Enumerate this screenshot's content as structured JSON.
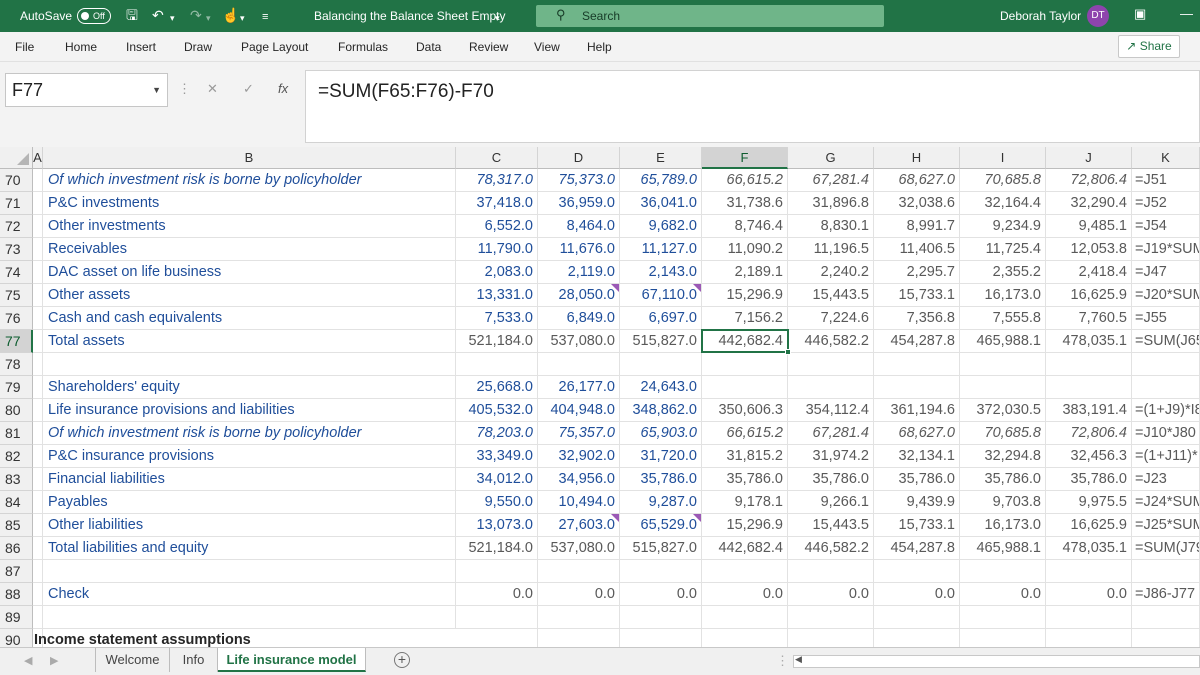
{
  "titlebar": {
    "autosave_label": "AutoSave",
    "autosave_state": "Off",
    "document_title": "Balancing the Balance Sheet Empty",
    "search_placeholder": "Search",
    "user_name": "Deborah Taylor",
    "user_initials": "DT",
    "accent_color": "#217346",
    "avatar_color": "#8e44ad"
  },
  "ribbon": {
    "tabs": [
      "File",
      "Home",
      "Insert",
      "Draw",
      "Page Layout",
      "Formulas",
      "Data",
      "Review",
      "View",
      "Help"
    ],
    "share_label": "Share"
  },
  "formula_bar": {
    "name_box": "F77",
    "formula": "=SUM(F65:F76)-F70"
  },
  "columns": [
    "A",
    "B",
    "C",
    "D",
    "E",
    "F",
    "G",
    "H",
    "I",
    "J",
    "K"
  ],
  "selected_column": "F",
  "selected_row": "77",
  "rows": [
    {
      "num": "70",
      "label": "Of which investment risk is borne by policyholder",
      "style": "italic",
      "values": [
        "78,317.0",
        "75,373.0",
        "65,789.0",
        "66,615.2",
        "67,281.4",
        "68,627.0",
        "70,685.8",
        "72,806.4"
      ],
      "k": "=J51"
    },
    {
      "num": "71",
      "label": "P&C investments",
      "style": "normal",
      "values": [
        "37,418.0",
        "36,959.0",
        "36,041.0",
        "31,738.6",
        "31,896.8",
        "32,038.6",
        "32,164.4",
        "32,290.4"
      ],
      "k": "=J52"
    },
    {
      "num": "72",
      "label": "Other investments",
      "style": "normal",
      "values": [
        "6,552.0",
        "8,464.0",
        "9,682.0",
        "8,746.4",
        "8,830.1",
        "8,991.7",
        "9,234.9",
        "9,485.1"
      ],
      "k": "=J54"
    },
    {
      "num": "73",
      "label": "Receivables",
      "style": "normal",
      "values": [
        "11,790.0",
        "11,676.0",
        "11,127.0",
        "11,090.2",
        "11,196.5",
        "11,406.5",
        "11,725.4",
        "12,053.8"
      ],
      "k": "=J19*SUM"
    },
    {
      "num": "74",
      "label": "DAC asset on life business",
      "style": "normal",
      "values": [
        "2,083.0",
        "2,119.0",
        "2,143.0",
        "2,189.1",
        "2,240.2",
        "2,295.7",
        "2,355.2",
        "2,418.4"
      ],
      "k": "=J47"
    },
    {
      "num": "75",
      "label": "Other assets",
      "style": "normal",
      "values": [
        "13,331.0",
        "28,050.0",
        "67,110.0",
        "15,296.9",
        "15,443.5",
        "15,733.1",
        "16,173.0",
        "16,625.9"
      ],
      "k": "=J20*SUM"
    },
    {
      "num": "76",
      "label": "Cash and cash equivalents",
      "style": "normal",
      "values": [
        "7,533.0",
        "6,849.0",
        "6,697.0",
        "7,156.2",
        "7,224.6",
        "7,356.8",
        "7,555.8",
        "7,760.5"
      ],
      "k": "=J55"
    },
    {
      "num": "77",
      "label": "Total assets",
      "style": "total",
      "values": [
        "521,184.0",
        "537,080.0",
        "515,827.0",
        "442,682.4",
        "446,582.2",
        "454,287.8",
        "465,988.1",
        "478,035.1"
      ],
      "k": "=SUM(J65"
    },
    {
      "num": "78",
      "label": "",
      "style": "normal",
      "values": [
        "",
        "",
        "",
        "",
        "",
        "",
        "",
        ""
      ],
      "k": ""
    },
    {
      "num": "79",
      "label": "Shareholders' equity",
      "style": "normal",
      "values": [
        "25,668.0",
        "26,177.0",
        "24,643.0",
        "",
        "",
        "",
        "",
        ""
      ],
      "k": ""
    },
    {
      "num": "80",
      "label": "Life insurance provisions and liabilities",
      "style": "normal",
      "values": [
        "405,532.0",
        "404,948.0",
        "348,862.0",
        "350,606.3",
        "354,112.4",
        "361,194.6",
        "372,030.5",
        "383,191.4"
      ],
      "k": "=(1+J9)*I8"
    },
    {
      "num": "81",
      "label": "Of which investment risk is borne by policyholder",
      "style": "italic",
      "values": [
        "78,203.0",
        "75,357.0",
        "65,903.0",
        "66,615.2",
        "67,281.4",
        "68,627.0",
        "70,685.8",
        "72,806.4"
      ],
      "k": "=J10*J80"
    },
    {
      "num": "82",
      "label": "P&C insurance provisions",
      "style": "normal",
      "values": [
        "33,349.0",
        "32,902.0",
        "31,720.0",
        "31,815.2",
        "31,974.2",
        "32,134.1",
        "32,294.8",
        "32,456.3"
      ],
      "k": "=(1+J11)*"
    },
    {
      "num": "83",
      "label": "Financial liabilities",
      "style": "normal",
      "values": [
        "34,012.0",
        "34,956.0",
        "35,786.0",
        "35,786.0",
        "35,786.0",
        "35,786.0",
        "35,786.0",
        "35,786.0"
      ],
      "k": "=J23"
    },
    {
      "num": "84",
      "label": "Payables",
      "style": "normal",
      "values": [
        "9,550.0",
        "10,494.0",
        "9,287.0",
        "9,178.1",
        "9,266.1",
        "9,439.9",
        "9,703.8",
        "9,975.5"
      ],
      "k": "=J24*SUM"
    },
    {
      "num": "85",
      "label": "Other liabilities",
      "style": "normal",
      "values": [
        "13,073.0",
        "27,603.0",
        "65,529.0",
        "15,296.9",
        "15,443.5",
        "15,733.1",
        "16,173.0",
        "16,625.9"
      ],
      "k": "=J25*SUM"
    },
    {
      "num": "86",
      "label": "Total liabilities and equity",
      "style": "total",
      "values": [
        "521,184.0",
        "537,080.0",
        "515,827.0",
        "442,682.4",
        "446,582.2",
        "454,287.8",
        "465,988.1",
        "478,035.1"
      ],
      "k": "=SUM(J79"
    },
    {
      "num": "87",
      "label": "",
      "style": "normal",
      "values": [
        "",
        "",
        "",
        "",
        "",
        "",
        "",
        ""
      ],
      "k": ""
    },
    {
      "num": "88",
      "label": "Check",
      "style": "check",
      "values": [
        "0.0",
        "0.0",
        "0.0",
        "0.0",
        "0.0",
        "0.0",
        "0.0",
        "0.0"
      ],
      "k": "=J86-J77"
    },
    {
      "num": "89",
      "label": "",
      "style": "normal",
      "values": [
        "",
        "",
        "",
        "",
        "",
        "",
        "",
        ""
      ],
      "k": ""
    },
    {
      "num": "90",
      "label": "Income statement assumptions",
      "style": "section",
      "values": [
        "",
        "",
        "",
        "",
        "",
        "",
        "",
        ""
      ],
      "k": ""
    }
  ],
  "comment_marks": [
    "75-D",
    "75-E",
    "85-D",
    "85-E"
  ],
  "sheet_tabs": [
    "Welcome",
    "Info",
    "Life insurance model"
  ],
  "active_sheet": "Life insurance model"
}
